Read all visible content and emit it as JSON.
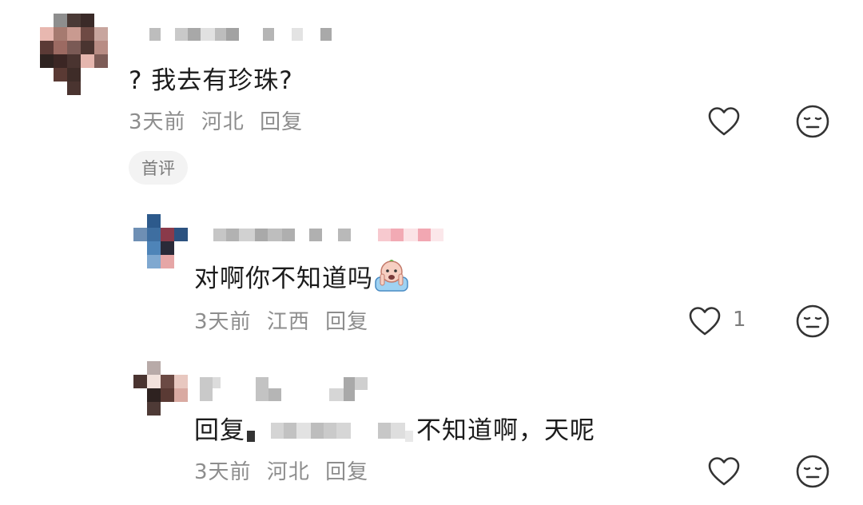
{
  "comments": [
    {
      "text": "? 我去有珍珠?",
      "time": "3天前",
      "location": "河北",
      "reply_label": "回复",
      "tag": "首评"
    },
    {
      "text": "对啊你不知道吗",
      "time": "3天前",
      "location": "江西",
      "reply_label": "回复",
      "like_count": "1"
    },
    {
      "text_prefix": "回复",
      "text_suffix": "不知道啊，天呢",
      "time": "3天前",
      "location": "河北",
      "reply_label": "回复"
    }
  ],
  "icons": {
    "like": "heart-icon",
    "dislike": "meh-face-icon",
    "emoji": "crying-face-emoji"
  },
  "colors": {
    "text": "#1c1c1c",
    "meta": "#8d8d8d",
    "icon": "#333333",
    "tag_bg": "#f3f3f3"
  }
}
